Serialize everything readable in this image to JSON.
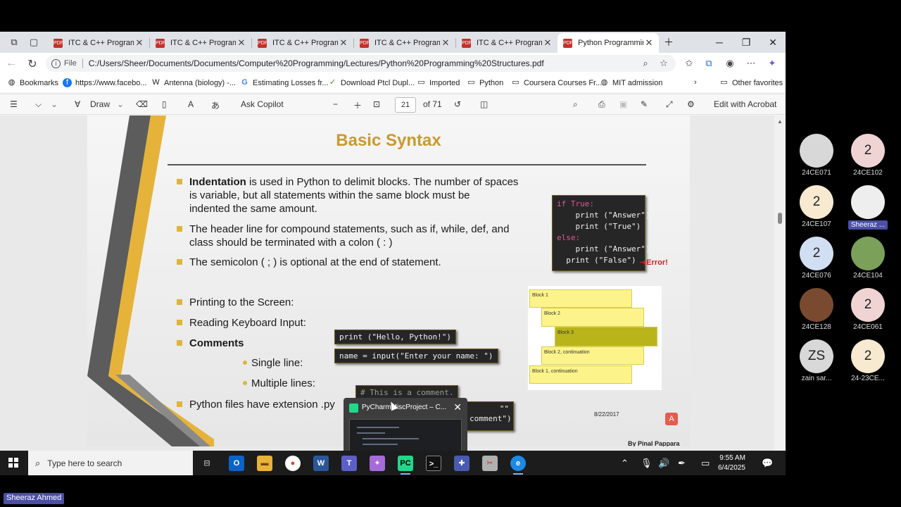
{
  "tabs": [
    {
      "label": "ITC & C++ Programmi",
      "active": false
    },
    {
      "label": "ITC & C++ Programmi",
      "active": false
    },
    {
      "label": "ITC & C++ Programmi",
      "active": false
    },
    {
      "label": "ITC & C++ Programmi",
      "active": false
    },
    {
      "label": "ITC & C++ Programmi",
      "active": false
    },
    {
      "label": "Python Programming",
      "active": true
    }
  ],
  "address": {
    "scheme_label": "File",
    "url": "C:/Users/Sheer/Documents/Documents/Computer%20Programming/Lectures/Python%20Programming%20Structures.pdf"
  },
  "bookmarks": [
    {
      "label": "Bookmarks",
      "icon": "globe-icon"
    },
    {
      "label": "https://www.facebo...",
      "icon": "facebook-icon"
    },
    {
      "label": "Antenna (biology) -...",
      "icon": "wikipedia-icon"
    },
    {
      "label": "Estimating Losses fr...",
      "icon": "google-icon"
    },
    {
      "label": "Download Ptcl Dupl...",
      "icon": "check-icon"
    },
    {
      "label": "Imported",
      "icon": "folder-icon"
    },
    {
      "label": "Python",
      "icon": "folder-icon"
    },
    {
      "label": "Coursera Courses Fr...",
      "icon": "folder-icon"
    },
    {
      "label": "MIT admission",
      "icon": "globe-icon"
    },
    {
      "label": "Other favorites",
      "icon": "folder-icon"
    }
  ],
  "pdf_toolbar": {
    "draw": "Draw",
    "ask_copilot": "Ask Copilot",
    "page": "21",
    "of_pages": "of 71",
    "edit_acrobat": "Edit with Acrobat"
  },
  "slide": {
    "title": "Basic Syntax",
    "bullet1_bold": "Indentation",
    "bullet1_line1": " is used in Python to delimit blocks. The number of spaces",
    "bullet1_line2": "is variable, but all statements within the same block must be",
    "bullet1_line3": "indented the same amount.",
    "bullet2_line1": "The header line for compound statements, such as if, while, def, and",
    "bullet2_line2": "class should be terminated with a colon ( : )",
    "bullet3": "The semicolon ( ; ) is optional at the end of statement.",
    "bullet4": "Printing to the Screen:",
    "bullet5": "Reading Keyboard Input:",
    "bullet6": "Comments",
    "sub1": "Single line:",
    "sub2": "Multiple lines:",
    "bullet7": "Python files have extension .py",
    "code_print": "print (\"Hello, Python!\")",
    "code_input": "name = input(\"Enter your name: \")",
    "code_comment": "# This is a comment.",
    "code_multi1": "\"\"",
    "code_multi2": "comment\")",
    "code_block": {
      "l1": "if True:",
      "l2": "    print (\"Answer\")",
      "l3": "    print (\"True\")",
      "l4": "else:",
      "l5": "    print (\"Answer\")",
      "l6": "  print (\"False\")"
    },
    "error_label": "Error!",
    "blocks": [
      "Block 1",
      "Block 2",
      "Block 3",
      "Block 2, continuation",
      "Block 1, continuation"
    ],
    "date": "8/22/2017",
    "author": "By Pinal Pappara"
  },
  "preview": {
    "title": "PyCharmMiscProject – C..."
  },
  "taskbar": {
    "search_placeholder": "Type here to search",
    "time": "9:55 AM",
    "date": "6/4/2025"
  },
  "participants": [
    {
      "initials": "",
      "name": "24CE071",
      "color": "#d8d8d8"
    },
    {
      "initials": "2",
      "name": "24CE102",
      "color": "#f0d4d4"
    },
    {
      "initials": "2",
      "name": "24CE107",
      "color": "#f7ead0"
    },
    {
      "initials": "",
      "name": "Sheeraz ...",
      "color": "#eeeeee"
    },
    {
      "initials": "2",
      "name": "24CE076",
      "color": "#d2dff2"
    },
    {
      "initials": "",
      "name": "24CE104",
      "color": "#7aa05a"
    },
    {
      "initials": "",
      "name": "24CE128",
      "color": "#7a4a30"
    },
    {
      "initials": "2",
      "name": "24CE061",
      "color": "#f0d4d4"
    },
    {
      "initials": "ZS",
      "name": "zain sar...",
      "color": "#d8d8d8"
    },
    {
      "initials": "2",
      "name": "24-23CE...",
      "color": "#f7ead0"
    }
  ],
  "presenter": "Sheeraz Ahmed"
}
